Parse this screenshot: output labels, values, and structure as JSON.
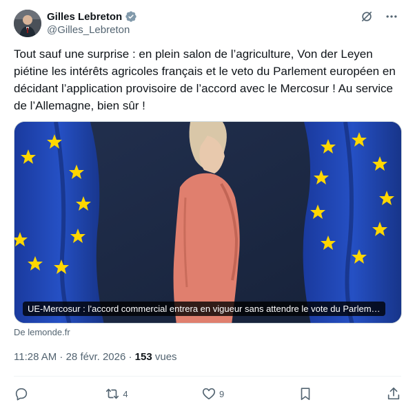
{
  "author": {
    "name": "Gilles Lebreton",
    "handle": "@Gilles_Lebreton",
    "verified_color": "#829aab"
  },
  "tweet": {
    "text": "Tout sauf une surprise : en plein salon de l’agriculture, Von der Leyen piétine les intérêts agricoles français et le veto du Parlement européen en décidant l’application provisoire de l’accord avec le Mercosur ! Au service de l’Allemagne, bien sûr !"
  },
  "card": {
    "caption": "UE-Mercosur : l’accord commercial entrera en vigueur sans attendre le vote du Parlem…",
    "source": "De lemonde.fr"
  },
  "meta": {
    "time": "11:28 AM · 28 févr. 2026 · ",
    "views_count": "153",
    "views_label": " vues"
  },
  "actions": {
    "reply_count": "",
    "retweet_count": "4",
    "like_count": "9"
  },
  "icons": {
    "grok": "grok-icon",
    "more": "more-icon",
    "reply": "reply-icon",
    "retweet": "retweet-icon",
    "like": "like-icon",
    "bookmark": "bookmark-icon",
    "share": "share-icon"
  },
  "colors": {
    "text": "#0f1419",
    "secondary": "#536471",
    "eu_blue": "#1e40a8",
    "eu_star": "#ffd700",
    "jacket": "#e07f6e"
  }
}
